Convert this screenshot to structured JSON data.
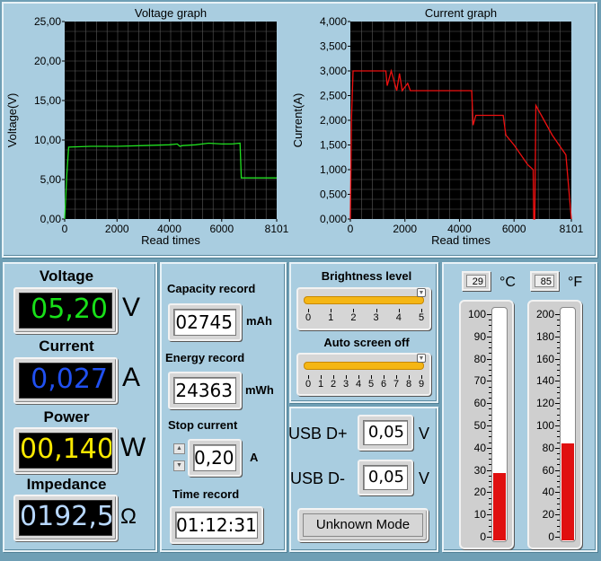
{
  "voltage_graph": {
    "title": "Voltage graph",
    "xlabel": "Read times",
    "ylabel": "Voltage(V)",
    "y_ticks": [
      "0,00",
      "5,00",
      "10,00",
      "15,00",
      "20,00",
      "25,00"
    ],
    "x_ticks": [
      "0",
      "2000",
      "4000",
      "6000",
      "8101"
    ],
    "line_color": "#20e020"
  },
  "current_graph": {
    "title": "Current graph",
    "xlabel": "Read times",
    "ylabel": "Current(A)",
    "y_ticks": [
      "0,000",
      "0,500",
      "1,000",
      "1,500",
      "2,000",
      "2,500",
      "3,000",
      "3,500",
      "4,000"
    ],
    "x_ticks": [
      "0",
      "2000",
      "4000",
      "6000",
      "8101"
    ],
    "line_color": "#ee1010"
  },
  "chart_data": [
    {
      "type": "line",
      "title": "Voltage graph",
      "xlabel": "Read times",
      "ylabel": "Voltage(V)",
      "xlim": [
        0,
        8101
      ],
      "ylim": [
        0,
        25
      ],
      "grid": true,
      "series": [
        {
          "x": [
            0,
            80,
            150,
            1000,
            2000,
            3000,
            4000,
            4300,
            4400,
            4500,
            5000,
            5500,
            6000,
            6400,
            6700,
            6750,
            7000,
            8101
          ],
          "y": [
            0.0,
            5.5,
            9.1,
            9.2,
            9.2,
            9.3,
            9.4,
            9.5,
            9.2,
            9.3,
            9.4,
            9.6,
            9.5,
            9.5,
            9.6,
            5.2,
            5.2,
            5.2
          ]
        }
      ]
    },
    {
      "type": "line",
      "title": "Current graph",
      "xlabel": "Read times",
      "ylabel": "Current(A)",
      "xlim": [
        0,
        8101
      ],
      "ylim": [
        0,
        4
      ],
      "grid": true,
      "series": [
        {
          "x": [
            0,
            40,
            100,
            200,
            500,
            1000,
            1300,
            1350,
            1500,
            1700,
            1800,
            1900,
            2100,
            2200,
            3000,
            4000,
            4450,
            4500,
            4600,
            5200,
            5600,
            5700,
            6000,
            6500,
            6700,
            6720,
            6760,
            6800,
            7000,
            7400,
            7900,
            8101
          ],
          "y": [
            0.0,
            2.0,
            3.0,
            3.0,
            3.0,
            3.0,
            3.0,
            2.7,
            3.0,
            2.6,
            2.95,
            2.6,
            2.75,
            2.6,
            2.6,
            2.6,
            2.6,
            1.9,
            2.1,
            2.1,
            2.1,
            1.7,
            1.5,
            1.1,
            1.0,
            0.0,
            0.0,
            2.3,
            2.1,
            1.7,
            1.3,
            0.0
          ]
        }
      ]
    }
  ],
  "readouts": {
    "voltage": {
      "label": "Voltage",
      "value": "05,20",
      "unit": "V",
      "color": "#18e018"
    },
    "current": {
      "label": "Current",
      "value": "0,027",
      "unit": "A",
      "color": "#2050f0"
    },
    "power": {
      "label": "Power",
      "value": "00,140",
      "unit": "W",
      "color": "#f8e800"
    },
    "impedance": {
      "label": "Impedance",
      "value": "0192,5",
      "unit": "Ω",
      "color": "#b8d8ff"
    }
  },
  "records": {
    "capacity": {
      "label": "Capacity record",
      "value": "02745",
      "unit": "mAh"
    },
    "energy": {
      "label": "Energy record",
      "value": "24363",
      "unit": "mWh"
    },
    "stop_current": {
      "label": "Stop current",
      "value": "0,20",
      "unit": "A"
    },
    "time": {
      "label": "Time record",
      "value": "01:12:31"
    }
  },
  "brightness": {
    "label": "Brightness level",
    "ticks": [
      "0",
      "1",
      "2",
      "3",
      "4",
      "5"
    ],
    "value": 5,
    "max": 5
  },
  "screen_off": {
    "label": "Auto screen off",
    "ticks": [
      "0",
      "1",
      "2",
      "3",
      "4",
      "5",
      "6",
      "7",
      "8",
      "9"
    ],
    "value": 9,
    "max": 9
  },
  "usb": {
    "dplus": {
      "label": "USB D+",
      "value": "0,05",
      "unit": "V"
    },
    "dminus": {
      "label": "USB D-",
      "value": "0,05",
      "unit": "V"
    },
    "mode_button": "Unknown Mode"
  },
  "temperature": {
    "celsius": {
      "value": "29",
      "unit": "°C",
      "level": 29,
      "max": 100,
      "ticks": [
        "100",
        "90",
        "80",
        "70",
        "60",
        "50",
        "40",
        "30",
        "20",
        "10",
        "0"
      ]
    },
    "fahrenheit": {
      "value": "85",
      "unit": "°F",
      "level": 85,
      "max": 200,
      "ticks": [
        "200",
        "180",
        "160",
        "140",
        "120",
        "100",
        "80",
        "60",
        "40",
        "20",
        "0"
      ]
    }
  },
  "colors": {
    "panel": "#a9cde0",
    "background": "#6f9fb5",
    "slider": "#f5b614"
  }
}
